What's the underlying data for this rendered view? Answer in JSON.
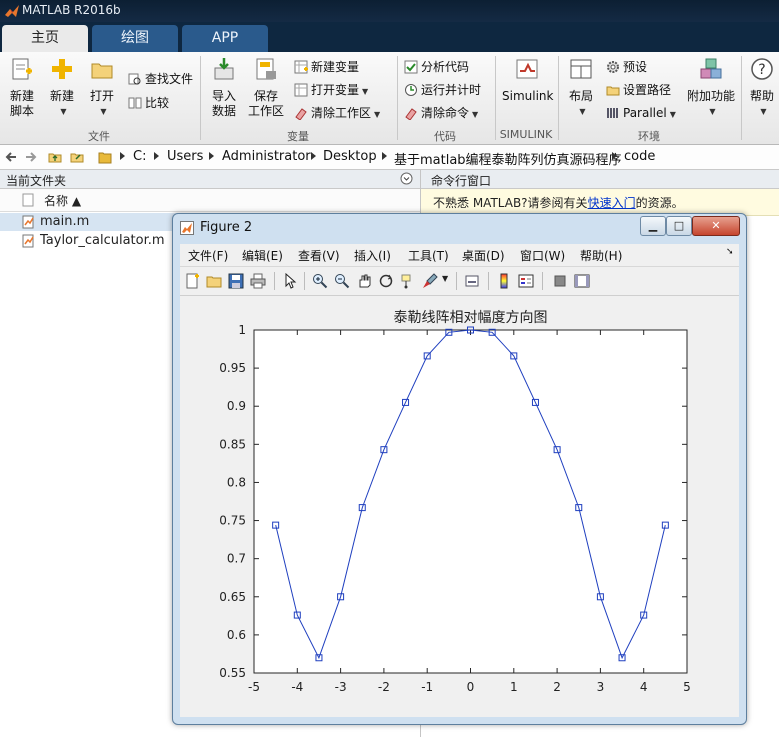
{
  "window": {
    "title": "MATLAB R2016b"
  },
  "tabs": [
    {
      "label": "主页",
      "active": true
    },
    {
      "label": "绘图",
      "active": false
    },
    {
      "label": "APP",
      "active": false
    }
  ],
  "ribbon": {
    "file_group": {
      "label": "文件",
      "new_script": "新建\n脚本",
      "new": "新建",
      "open": "打开",
      "find_files": "查找文件",
      "compare": "比较"
    },
    "variable_group": {
      "label": "变量",
      "import": "导入\n数据",
      "save_ws": "保存\n工作区",
      "new_var": "新建变量",
      "open_var": "打开变量",
      "clear_ws": "清除工作区"
    },
    "code_group": {
      "label": "代码",
      "analyze": "分析代码",
      "run_time": "运行并计时",
      "clear_cmd": "清除命令"
    },
    "simulink_group": {
      "label": "SIMULINK",
      "simulink": "Simulink"
    },
    "env_group": {
      "label": "环境",
      "layout": "布局",
      "prefs": "预设",
      "set_path": "设置路径",
      "parallel": "Parallel",
      "addons": "附加功能"
    },
    "help": "帮助"
  },
  "address": {
    "crumbs": [
      "C:",
      "Users",
      "Administrator",
      "Desktop",
      "基于matlab编程泰勒阵列仿真源码程序",
      "code"
    ]
  },
  "left_panel": {
    "title": "当前文件夹",
    "column": "名称 ▲",
    "files": [
      {
        "name": "main.m",
        "selected": true
      },
      {
        "name": "Taylor_calculator.m",
        "selected": false
      }
    ]
  },
  "right_panel": {
    "title": "命令行窗口",
    "hint_prefix": "不熟悉 MATLAB?请参阅有关",
    "hint_link": "快速入门",
    "hint_suffix": "的资源。"
  },
  "figure": {
    "title": "Figure 2",
    "menu": [
      "文件(F)",
      "编辑(E)",
      "查看(V)",
      "插入(I)",
      "工具(T)",
      "桌面(D)",
      "窗口(W)",
      "帮助(H)"
    ],
    "colors": {
      "line": "#1f3fbf",
      "axes_bg": "#ffffff",
      "window_bg": "#f0f0f0"
    }
  },
  "chart_data": {
    "type": "line",
    "title": "泰勒线阵相对幅度方向图",
    "xlabel": "",
    "ylabel": "",
    "xlim": [
      -5,
      5
    ],
    "ylim": [
      0.55,
      1
    ],
    "xticks": [
      -5,
      -4,
      -3,
      -2,
      -1,
      0,
      1,
      2,
      3,
      4,
      5
    ],
    "yticks": [
      0.55,
      0.6,
      0.65,
      0.7,
      0.75,
      0.8,
      0.85,
      0.9,
      0.95,
      1
    ],
    "ytick_labels": [
      "0.55",
      "0.6",
      "0.65",
      "0.7",
      "0.75",
      "0.8",
      "0.85",
      "0.9",
      "0.95",
      "1"
    ],
    "marker": "square",
    "grid": false,
    "series": [
      {
        "x": [
          -4.5,
          -4,
          -3.5,
          -3,
          -2.5,
          -2,
          -1.5,
          -1,
          -0.5,
          0,
          0.5,
          1,
          1.5,
          2,
          2.5,
          3,
          3.5,
          4,
          4.5
        ],
        "y": [
          0.744,
          0.626,
          0.57,
          0.65,
          0.767,
          0.843,
          0.905,
          0.966,
          0.997,
          1.0,
          0.997,
          0.966,
          0.905,
          0.843,
          0.767,
          0.65,
          0.57,
          0.626,
          0.744
        ]
      }
    ]
  }
}
